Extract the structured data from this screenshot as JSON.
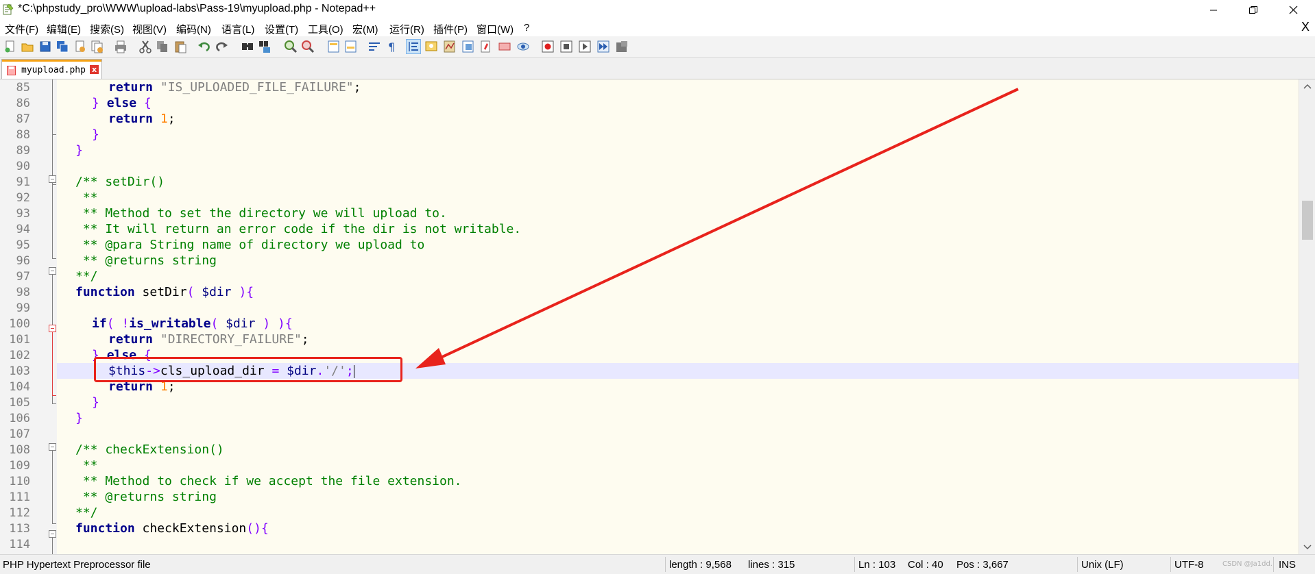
{
  "window": {
    "title": "*C:\\phpstudy_pro\\WWW\\upload-labs\\Pass-19\\myupload.php - Notepad++",
    "app_icon": "notepad-plus-plus-icon"
  },
  "menu": {
    "items": [
      "文件(F)",
      "编辑(E)",
      "搜索(S)",
      "视图(V)",
      "编码(N)",
      "语言(L)",
      "设置(T)",
      "工具(O)",
      "宏(M)",
      "运行(R)",
      "插件(P)",
      "窗口(W)",
      "?"
    ],
    "close_label": "X"
  },
  "toolbar": {
    "buttons": [
      "new-file-icon",
      "open-file-icon",
      "save-icon",
      "save-all-icon",
      "close-icon",
      "close-all-icon",
      "print-icon",
      "cut-icon",
      "copy-icon",
      "paste-icon",
      "undo-icon",
      "redo-icon",
      "find-icon",
      "replace-icon",
      "zoom-in-icon",
      "zoom-out-icon",
      "sync-vertical-icon",
      "sync-horizontal-icon",
      "word-wrap-icon",
      "show-all-chars-icon",
      "indent-guide-icon",
      "user-language-icon",
      "document-map-icon",
      "function-list-icon",
      "folder-as-workspace-icon",
      "monitoring-icon",
      "eye-icon",
      "record-macro-icon",
      "stop-recording-icon",
      "playback-macro-icon",
      "run-macro-multiple-icon",
      "save-macro-icon"
    ]
  },
  "tab": {
    "label": "myupload.php",
    "close_label": "x"
  },
  "editor": {
    "current_line": 103,
    "lines": [
      {
        "n": "85"
      },
      {
        "n": "86"
      },
      {
        "n": "87"
      },
      {
        "n": "88"
      },
      {
        "n": "89"
      },
      {
        "n": "90"
      },
      {
        "n": "91"
      },
      {
        "n": "92"
      },
      {
        "n": "93"
      },
      {
        "n": "94"
      },
      {
        "n": "95"
      },
      {
        "n": "96"
      },
      {
        "n": "97"
      },
      {
        "n": "98"
      },
      {
        "n": "99"
      },
      {
        "n": "100"
      },
      {
        "n": "101"
      },
      {
        "n": "102"
      },
      {
        "n": "103"
      },
      {
        "n": "104"
      },
      {
        "n": "105"
      },
      {
        "n": "106"
      },
      {
        "n": "107"
      },
      {
        "n": "108"
      },
      {
        "n": "109"
      },
      {
        "n": "110"
      },
      {
        "n": "111"
      },
      {
        "n": "112"
      },
      {
        "n": "113"
      },
      {
        "n": "114"
      }
    ],
    "code": {
      "l85_kw": "return",
      "l85_str": "\"IS_UPLOADED_FILE_FAILURE\"",
      "l86_kw": "else",
      "l87_kw": "return",
      "l87_num": "1",
      "l91_cmt": "/** setDir()",
      "l92_cmt": " **",
      "l93_cmt": " ** Method to set the directory we will upload to.",
      "l94_cmt": " ** It will return an error code if the dir is not writable.",
      "l95_cmt": " ** @para String name of directory we upload to",
      "l96_cmt": " ** @returns string",
      "l97_cmt": "**/",
      "l98_kw": "function",
      "l98_fn": " setDir",
      "l98_var": "$dir",
      "l100_kw": "if",
      "l100_fn": "is_writable",
      "l100_var": "$dir",
      "l101_kw": "return",
      "l101_str": "\"DIRECTORY_FAILURE\"",
      "l102_kw": "else",
      "l103_var": "$this",
      "l103_prop": "cls_upload_dir",
      "l103_var2": "$dir",
      "l103_str": "'/'",
      "l104_kw": "return",
      "l104_num": "1",
      "l108_cmt": "/** checkExtension()",
      "l109_cmt": " **",
      "l110_cmt": " ** Method to check if we accept the file extension.",
      "l111_cmt": " ** @returns string",
      "l112_cmt": "**/",
      "l113_kw": "function",
      "l113_fn": " checkExtension"
    }
  },
  "status": {
    "file_type": "PHP Hypertext Preprocessor file",
    "length": "length : 9,568",
    "lines": "lines : 315",
    "ln": "Ln : 103",
    "col": "Col : 40",
    "pos": "Pos : 3,667",
    "eol": "Unix (LF)",
    "encoding": "UTF-8",
    "mode": "INS",
    "watermark": "CSDN @Ja1dd."
  },
  "colors": {
    "editor_bg": "#fefcf0",
    "current_line_bg": "#e8e8ff",
    "keyword": "#00008b",
    "comment": "#008000",
    "string": "#808080",
    "number": "#ff8000",
    "operator": "#8000ff",
    "annotation": "#e8231c",
    "tab_accent": "#f6a316"
  }
}
